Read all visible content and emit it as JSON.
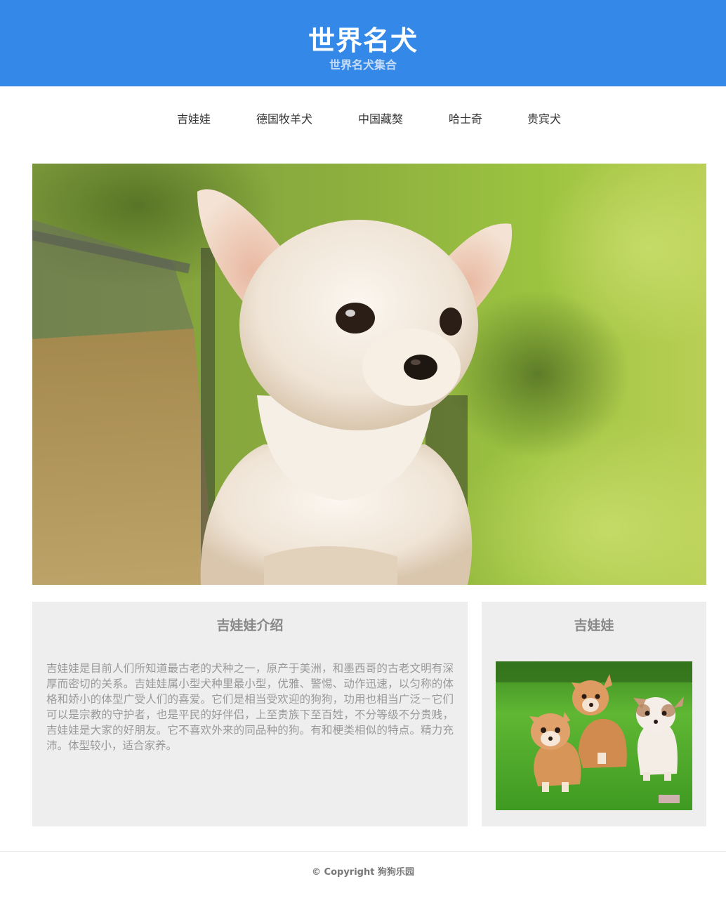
{
  "header": {
    "title": "世界名犬",
    "subtitle": "世界名犬集合"
  },
  "nav": {
    "items": [
      {
        "label": "吉娃娃"
      },
      {
        "label": "德国牧羊犬"
      },
      {
        "label": "中国藏獒"
      },
      {
        "label": "哈士奇"
      },
      {
        "label": "贵宾犬"
      }
    ]
  },
  "colors": {
    "brand": "#3489e8",
    "panel_bg": "#eeeeee",
    "text_muted": "#999999"
  },
  "intro": {
    "title": "吉娃娃介绍",
    "text": "吉娃娃是目前人们所知道最古老的犬种之一，原产于美洲，和墨西哥的古老文明有深厚而密切的关系。吉娃娃属小型犬种里最小型，优雅、警惕、动作迅速，以匀称的体格和娇小的体型广受人们的喜爱。它们是相当受欢迎的狗狗，功用也相当广泛－它们可以是宗教的守护者，也是平民的好伴侣，上至贵族下至百姓，不分等级不分贵贱，吉娃娃是大家的好朋友。它不喜欢外来的同品种的狗。有和梗类相似的特点。精力充沛。体型较小，适合家养。"
  },
  "side": {
    "title": "吉娃娃"
  },
  "footer": {
    "text": "© Copyright 狗狗乐园"
  }
}
